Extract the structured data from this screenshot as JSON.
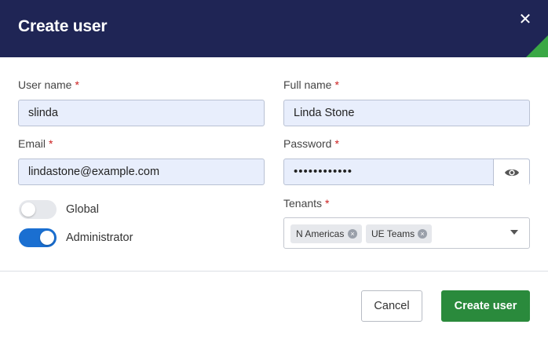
{
  "dialog": {
    "title": "Create user",
    "close_icon": "close-icon"
  },
  "form": {
    "username": {
      "label": "User name",
      "required": "*",
      "value": "slinda"
    },
    "fullname": {
      "label": "Full name",
      "required": "*",
      "value": "Linda Stone"
    },
    "email": {
      "label": "Email",
      "required": "*",
      "value": "lindastone@example.com"
    },
    "password": {
      "label": "Password",
      "required": "*",
      "value": "••••••••••••",
      "reveal_icon": "eye-icon"
    },
    "global": {
      "label": "Global",
      "checked": false
    },
    "administrator": {
      "label": "Administrator",
      "checked": true
    },
    "tenants": {
      "label": "Tenants",
      "required": "*",
      "selected": [
        "N Americas",
        "UE Teams"
      ],
      "remove_icon": "×",
      "dropdown_icon": "chevron-down-icon"
    }
  },
  "footer": {
    "cancel_label": "Cancel",
    "create_label": "Create user"
  },
  "colors": {
    "header_bg": "#1f2555",
    "accent_green": "#2a8a3c",
    "toggle_on": "#1a6fd1",
    "input_bg": "#e8eefc",
    "required": "#cc2020"
  }
}
